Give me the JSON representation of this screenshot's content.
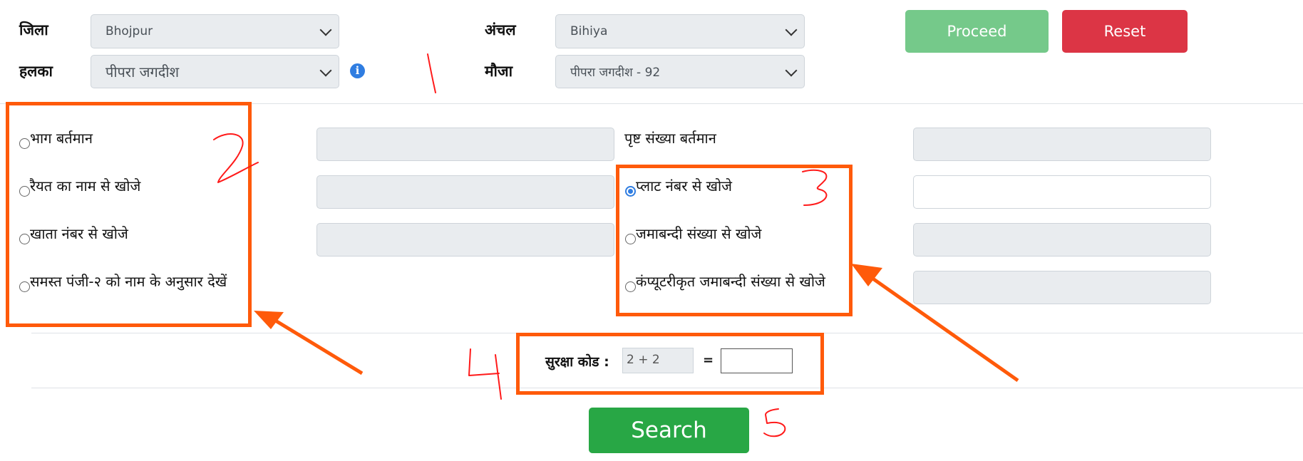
{
  "top": {
    "district_label": "जिला",
    "district_value": "Bhojpur",
    "anchal_label": "अंचल",
    "anchal_value": "Bihiya",
    "halka_label": "हलका",
    "halka_value": "पीपरा जगदीश",
    "mauja_label": "मौजा",
    "mauja_value": "पीपरा जगदीश - 92",
    "proceed_label": "Proceed",
    "reset_label": "Reset"
  },
  "options": {
    "left": [
      {
        "label": "भाग बर्तमान",
        "checked": false
      },
      {
        "label": "रैयत का नाम से खोजे",
        "checked": false
      },
      {
        "label": "खाता नंबर से खोजे",
        "checked": false
      },
      {
        "label": "समस्त पंजी-२ को नाम के अनुसार देखें",
        "checked": false
      }
    ],
    "page_label": "पृष्ट संख्या बर्तमान",
    "right": [
      {
        "label": "प्लाट नंबर से खोजे",
        "checked": true
      },
      {
        "label": "जमाबन्दी संख्या से खोजे",
        "checked": false
      },
      {
        "label": "कंप्यूटरीकृत जमाबन्दी संख्या से खोजे",
        "checked": false
      }
    ]
  },
  "captcha": {
    "label": "सुरक्षा कोड :",
    "question": "2 + 2",
    "equals": "=",
    "answer": ""
  },
  "search_label": "Search",
  "annotations": {
    "marks": [
      "1",
      "2",
      "3",
      "4",
      "5"
    ],
    "color": "#ff5a0a",
    "handwriting_color": "#ff1a1a"
  },
  "colors": {
    "proceed": "#75c98a",
    "reset": "#dc3545",
    "search": "#28a745",
    "info": "#2f7de1"
  }
}
